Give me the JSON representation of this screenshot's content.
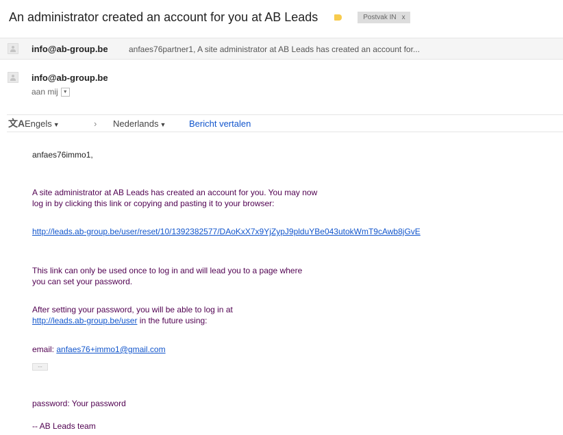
{
  "subject": "An administrator created an account for you at AB Leads",
  "label_color": "#f7cb4d",
  "inbox_chip": {
    "label": "Postvak IN",
    "close": "x"
  },
  "collapsed_message": {
    "sender": "info@ab-group.be",
    "snippet": "anfaes76partner1, A site administrator at AB Leads has created an account for..."
  },
  "open_message": {
    "sender": "info@ab-group.be",
    "to": "aan mij"
  },
  "translate_bar": {
    "source_language": "Engels",
    "arrow": "›",
    "target_language": "Nederlands",
    "action": "Bericht vertalen"
  },
  "body": {
    "greeting": "anfaes76immo1,",
    "para1_line1": "A site administrator at AB Leads has created an account for you. You may now",
    "para1_line2": "log in by clicking this link or copying and pasting it to your browser:",
    "reset_link": "http://leads.ab-group.be/user/reset/10/1392382577/DAoKxX7x9YjZypJ9plduYBe043utokWmT9cAwb8jGvE",
    "para2_line1": "This link can only be used once to log in and will lead you to a page where",
    "para2_line2": "you can set your password.",
    "para3_line1": "After setting your password, you will be able to log in at",
    "login_link": "http://leads.ab-group.be/user",
    "para3_suffix": " in the future using:",
    "email_label": "email: ",
    "email_value": "anfaes76+immo1@gmail.com",
    "show_trimmed": "...",
    "password_line": "password: Your password",
    "signature": "--  AB Leads team"
  },
  "colors": {
    "link": "#1155cc",
    "quoted_text": "#500050"
  }
}
